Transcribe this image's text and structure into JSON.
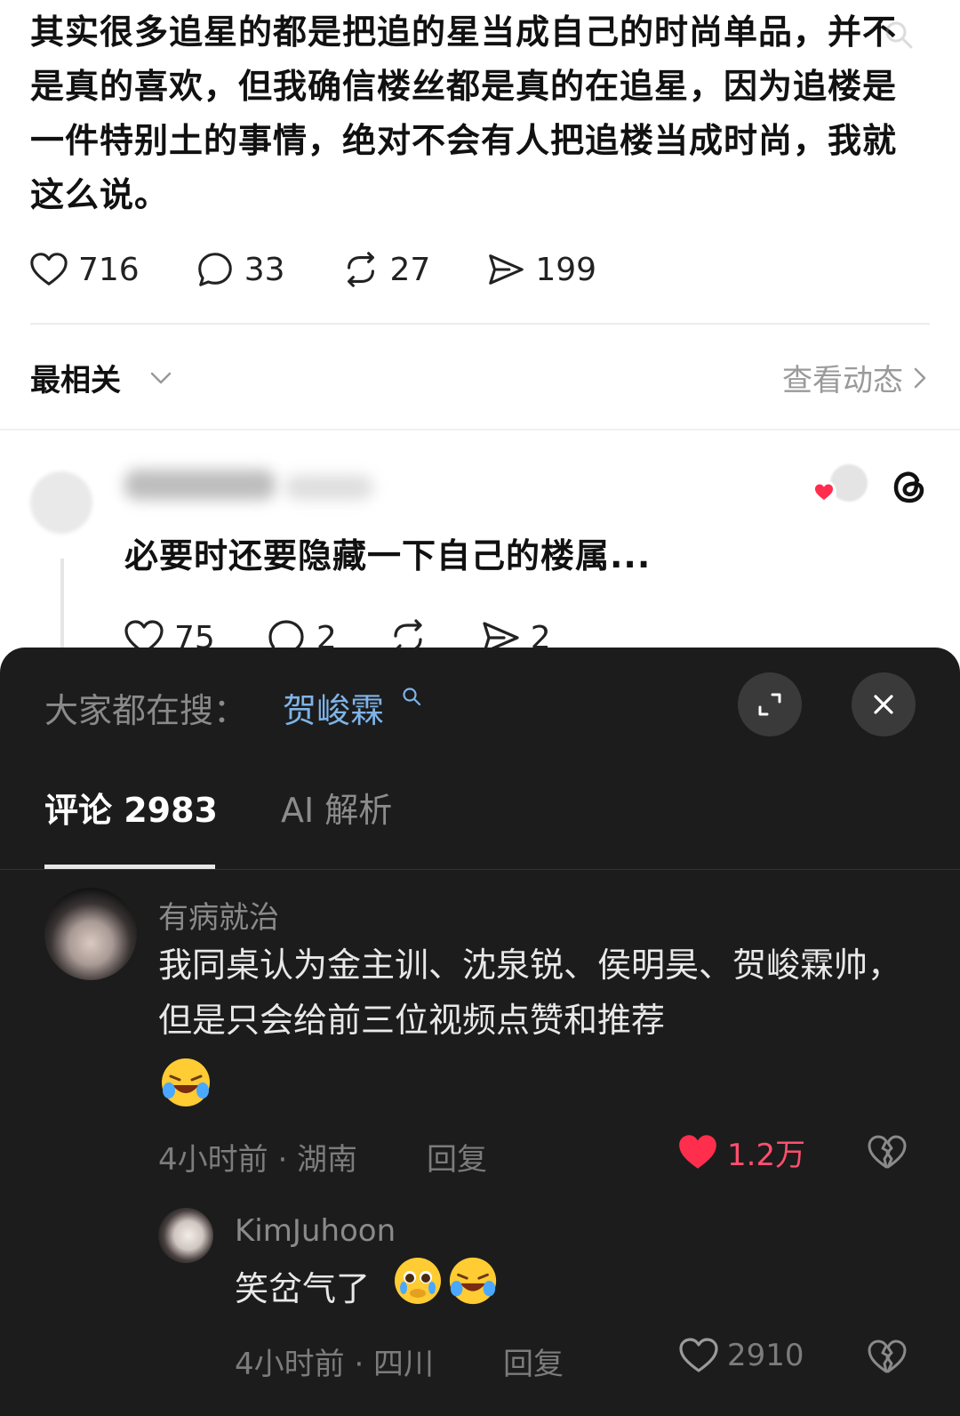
{
  "post": {
    "text": "其实很多追星的都是把追的星当成自己的时尚单品，并不是真的喜欢，但我确信楼丝都是真的在追星，因为追楼是一件特别土的事情，绝对不会有人把追楼当成时尚，我就这么说。",
    "likes": "716",
    "comments": "33",
    "reposts": "27",
    "shares": "199"
  },
  "sort": {
    "label": "最相关",
    "activity_link": "查看动态"
  },
  "reply": {
    "text": "必要时还要隐藏一下自己的楼属...",
    "likes": "75",
    "comments": "2",
    "shares": "2"
  },
  "sheet": {
    "search_label": "大家都在搜：",
    "search_term": "贺峻霖",
    "tabs": [
      {
        "label": "评论 2983",
        "active": true
      },
      {
        "label": "AI 解析",
        "active": false
      }
    ],
    "comments": [
      {
        "user": "有病就治",
        "text": "我同桌认为金主训、沈泉锐、侯明昊、贺峻霖帅，但是只会给前三位视频点赞和推荐",
        "meta": "4小时前 · 湖南",
        "reply_label": "回复",
        "likes": "1.2万",
        "liked": true
      },
      {
        "user": "KimJuhoon",
        "text": "笑岔气了",
        "meta": "4小时前 · 四川",
        "reply_label": "回复",
        "likes": "2910",
        "liked": false
      }
    ]
  },
  "colors": {
    "sheet_bg": "#1c1c1c",
    "search_term": "#7fb3e8",
    "liked_red": "#ff4f6e"
  }
}
